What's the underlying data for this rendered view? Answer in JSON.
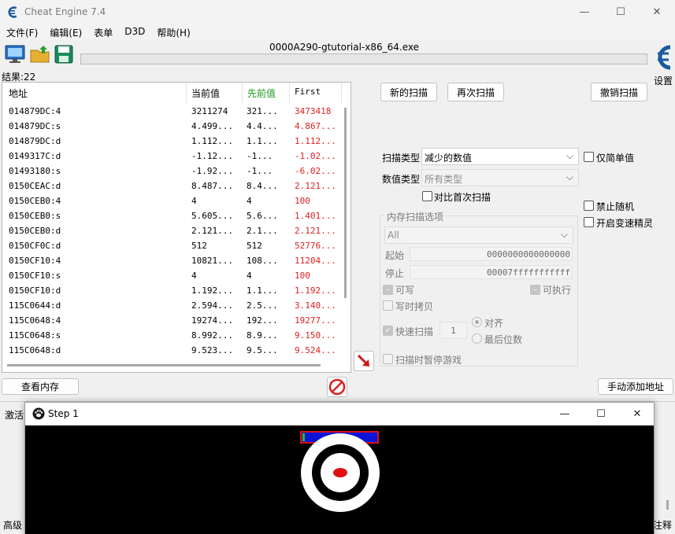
{
  "window": {
    "title": "Cheat Engine 7.4",
    "minimize": "—",
    "maximize": "☐",
    "close": "✕"
  },
  "menu": [
    "文件(F)",
    "编辑(E)",
    "表单",
    "D3D",
    "帮助(H)"
  ],
  "toolbar": {
    "process": "0000A290-gtutorial-x86_64.exe",
    "settings_label": "设置"
  },
  "results": {
    "count_label": "结果:22",
    "columns": [
      "地址",
      "当前值",
      "先前值",
      "First"
    ],
    "rows": [
      {
        "address": "014879DC:4",
        "current": "3211274",
        "previous": "321...",
        "first": "3473418"
      },
      {
        "address": "014879DC:s",
        "current": "4.499...",
        "previous": "4.4...",
        "first": "4.867..."
      },
      {
        "address": "014879DC:d",
        "current": "1.112...",
        "previous": "1.1...",
        "first": "1.112..."
      },
      {
        "address": "0149317C:d",
        "current": "-1.12...",
        "previous": "-1...",
        "first": "-1.02..."
      },
      {
        "address": "01493180:s",
        "current": "-1.92...",
        "previous": "-1...",
        "first": "-6.02..."
      },
      {
        "address": "0150CEAC:d",
        "current": "8.487...",
        "previous": "8.4...",
        "first": "2.121..."
      },
      {
        "address": "0150CEB0:4",
        "current": "4",
        "previous": "4",
        "first": "100"
      },
      {
        "address": "0150CEB0:s",
        "current": "5.605...",
        "previous": "5.6...",
        "first": "1.401..."
      },
      {
        "address": "0150CEB0:d",
        "current": "2.121...",
        "previous": "2.1...",
        "first": "2.121..."
      },
      {
        "address": "0150CF0C:d",
        "current": "512",
        "previous": "512",
        "first": "52776..."
      },
      {
        "address": "0150CF10:4",
        "current": "10821...",
        "previous": "108...",
        "first": "11204..."
      },
      {
        "address": "0150CF10:s",
        "current": "4",
        "previous": "4",
        "first": "100"
      },
      {
        "address": "0150CF10:d",
        "current": "1.192...",
        "previous": "1.1...",
        "first": "1.192..."
      },
      {
        "address": "115C0644:d",
        "current": "2.594...",
        "previous": "2.5...",
        "first": "3.140..."
      },
      {
        "address": "115C0648:4",
        "current": "19274...",
        "previous": "192...",
        "first": "19277..."
      },
      {
        "address": "115C0648:s",
        "current": "8.992...",
        "previous": "8.9...",
        "first": "9.150..."
      },
      {
        "address": "115C0648:d",
        "current": "9.523...",
        "previous": "9.5...",
        "first": "9.524..."
      }
    ]
  },
  "scan": {
    "new_scan": "新的扫描",
    "next_scan": "再次扫描",
    "undo_scan": "撤销扫描",
    "scan_type_label": "扫描类型",
    "scan_type_value": "减少的数值",
    "value_type_label": "数值类型",
    "value_type_value": "所有类型",
    "simple_values_label": "仅简单值",
    "compare_first_label": "对比首次扫描",
    "disable_random_label": "禁止随机",
    "speedhack_label": "开启变速精灵"
  },
  "memory": {
    "group_label": "内存扫描选项",
    "region_value": "All",
    "start_label": "起始",
    "start_value": "0000000000000000",
    "stop_label": "停止",
    "stop_value": "00007fffffffffff",
    "writable_label": "可写",
    "executable_label": "可执行",
    "copy_on_write_label": "写时拷贝",
    "fast_scan_label": "快速扫描",
    "fast_scan_value": "1",
    "align_label": "对齐",
    "last_digits_label": "最后位数",
    "pause_label": "扫描时暂停游戏"
  },
  "bottom": {
    "view_memory": "查看内存",
    "add_address": "手动添加地址",
    "activate_partial": "激活",
    "advanced_partial": "高级",
    "comment_partial": "注释"
  },
  "step_window": {
    "title": "Step 1",
    "minimize": "—",
    "maximize": "☐",
    "close": "✕"
  },
  "colors": {
    "accent_red": "#e02020",
    "prev_green": "#1a9a1a",
    "health_blue": "#0a14d8",
    "health_border": "#e01010"
  }
}
